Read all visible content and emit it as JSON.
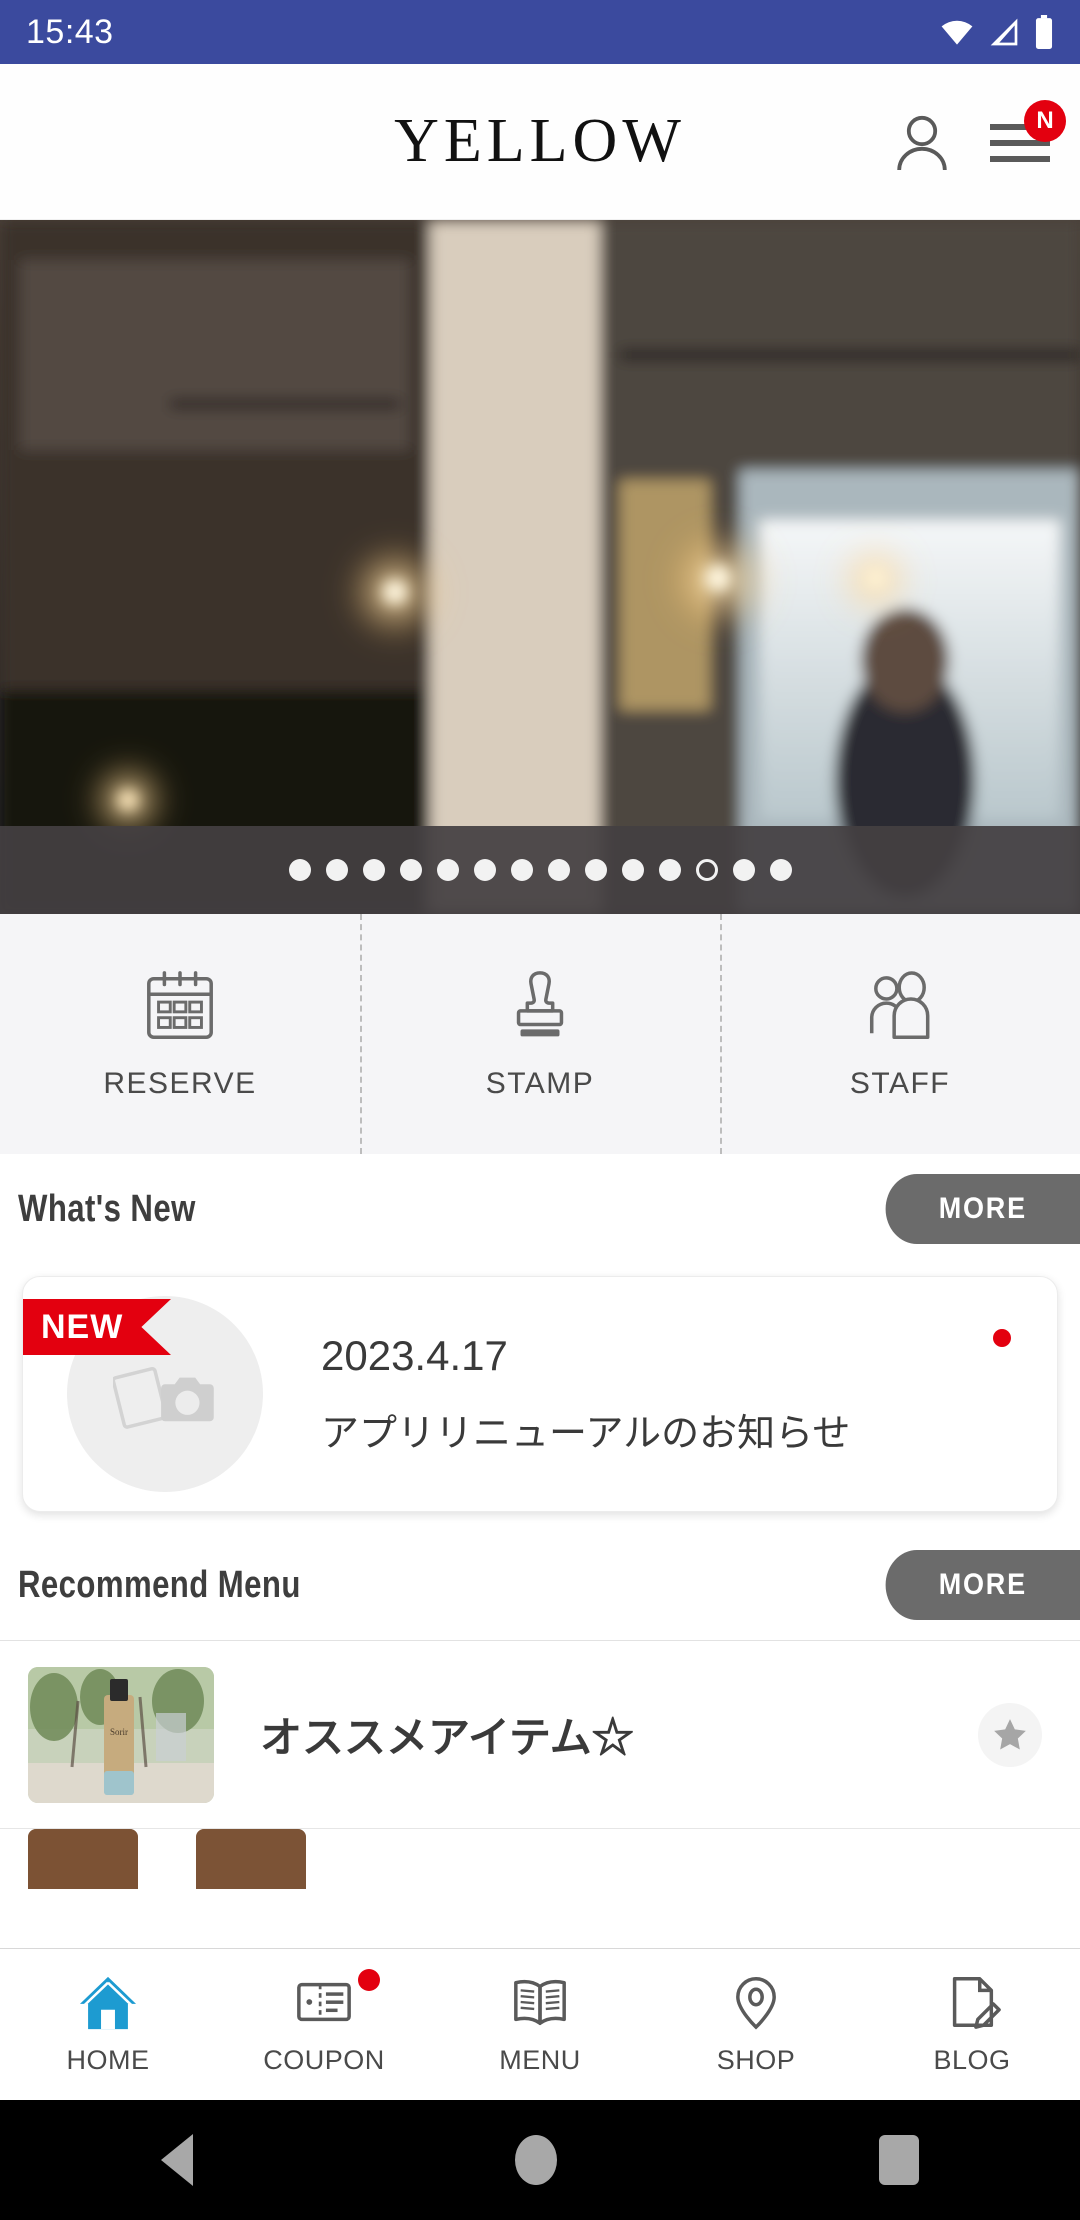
{
  "status_bar": {
    "time": "15:43",
    "icons": [
      "wifi-icon",
      "cellular-signal-icon",
      "battery-icon"
    ],
    "background_color": "#3b4a9e"
  },
  "header": {
    "brand": "YELLOW",
    "account_icon": "person-icon",
    "menu_icon": "hamburger-menu-icon",
    "menu_badge": "N",
    "badge_color": "#e3000f"
  },
  "hero": {
    "alt": "salon-interior-photo",
    "total_dots": 14,
    "active_index": 11
  },
  "quick_actions": [
    {
      "label": "RESERVE",
      "icon": "calendar-icon"
    },
    {
      "label": "STAMP",
      "icon": "stamp-icon"
    },
    {
      "label": "STAFF",
      "icon": "people-icon"
    }
  ],
  "whats_new": {
    "title": "What's New",
    "more_label": "MORE",
    "item": {
      "ribbon": "NEW",
      "date": "2023.4.17",
      "title": "アプリリニューアルのお知らせ",
      "thumb_icon": "photo-camera-placeholder-icon",
      "unread": true
    }
  },
  "recommend_menu": {
    "title": "Recommend Menu",
    "more_label": "MORE",
    "items": [
      {
        "name": "オススメアイテム☆",
        "favorite_icon": "star-icon",
        "thumb": "product-bottle-photo"
      }
    ]
  },
  "bottom_nav": {
    "active": "HOME",
    "active_color": "#1d9bd1",
    "items": [
      {
        "label": "HOME",
        "icon": "home-icon",
        "badge": false
      },
      {
        "label": "COUPON",
        "icon": "coupon-icon",
        "badge": true
      },
      {
        "label": "MENU",
        "icon": "book-icon",
        "badge": false
      },
      {
        "label": "SHOP",
        "icon": "location-pin-icon",
        "badge": false
      },
      {
        "label": "BLOG",
        "icon": "document-pen-icon",
        "badge": false
      }
    ]
  },
  "android_nav": {
    "back": "back-triangle-icon",
    "home": "home-circle-icon",
    "recents": "recents-square-icon"
  }
}
